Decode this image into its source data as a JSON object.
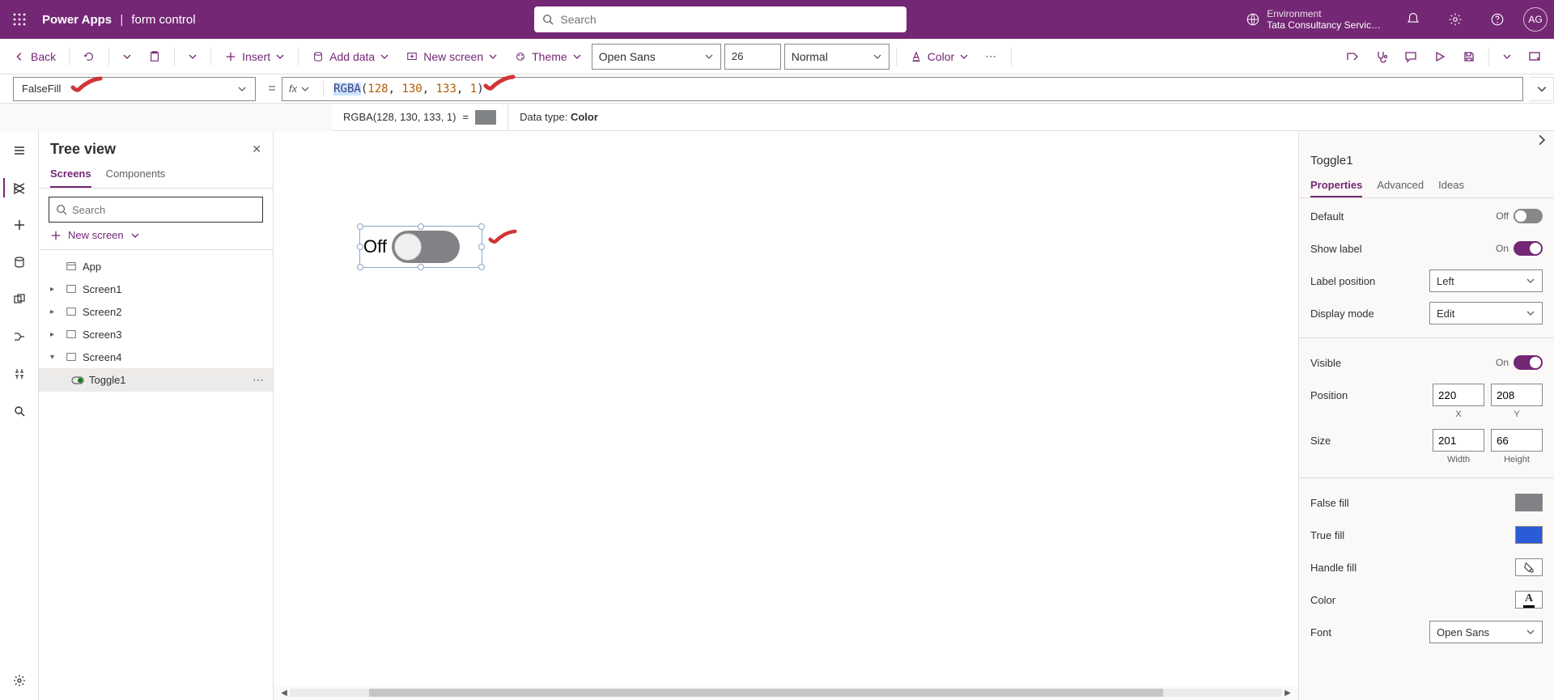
{
  "header": {
    "app_name": "Power Apps",
    "separator": "|",
    "doc_name": "form control",
    "search_placeholder": "Search",
    "env_label": "Environment",
    "env_name": "Tata Consultancy Servic…",
    "avatar": "AG"
  },
  "cmdbar": {
    "back": "Back",
    "insert": "Insert",
    "add_data": "Add data",
    "new_screen": "New screen",
    "theme": "Theme",
    "font_family": "Open Sans",
    "font_size": "26",
    "font_weight": "Normal",
    "color": "Color"
  },
  "formula": {
    "property": "FalseFill",
    "fx": "fx",
    "fn": "RGBA",
    "args": [
      "128",
      "130",
      "133",
      "1"
    ],
    "result_expr": "RGBA(128, 130, 133, 1)",
    "result_eq": "=",
    "data_type_label": "Data type:",
    "data_type": "Color"
  },
  "tree": {
    "title": "Tree view",
    "tab_screens": "Screens",
    "tab_components": "Components",
    "search_placeholder": "Search",
    "new_screen": "New screen",
    "app": "App",
    "screens": [
      "Screen1",
      "Screen2",
      "Screen3",
      "Screen4"
    ],
    "toggle": "Toggle1"
  },
  "canvas": {
    "toggle_label": "Off"
  },
  "props": {
    "name": "Toggle1",
    "tab_props": "Properties",
    "tab_adv": "Advanced",
    "tab_ideas": "Ideas",
    "default_label": "Default",
    "default_value": "Off",
    "show_label_label": "Show label",
    "show_label_value": "On",
    "label_pos_label": "Label position",
    "label_pos_value": "Left",
    "display_mode_label": "Display mode",
    "display_mode_value": "Edit",
    "visible_label": "Visible",
    "visible_value": "On",
    "position_label": "Position",
    "position_x": "220",
    "position_y": "208",
    "position_x_cap": "X",
    "position_y_cap": "Y",
    "size_label": "Size",
    "size_w": "201",
    "size_h": "66",
    "size_w_cap": "Width",
    "size_h_cap": "Height",
    "false_fill_label": "False fill",
    "false_fill_color": "#808285",
    "true_fill_label": "True fill",
    "true_fill_color": "#2b5bd6",
    "handle_fill_label": "Handle fill",
    "color_label": "Color",
    "font_label": "Font",
    "font_value": "Open Sans"
  }
}
